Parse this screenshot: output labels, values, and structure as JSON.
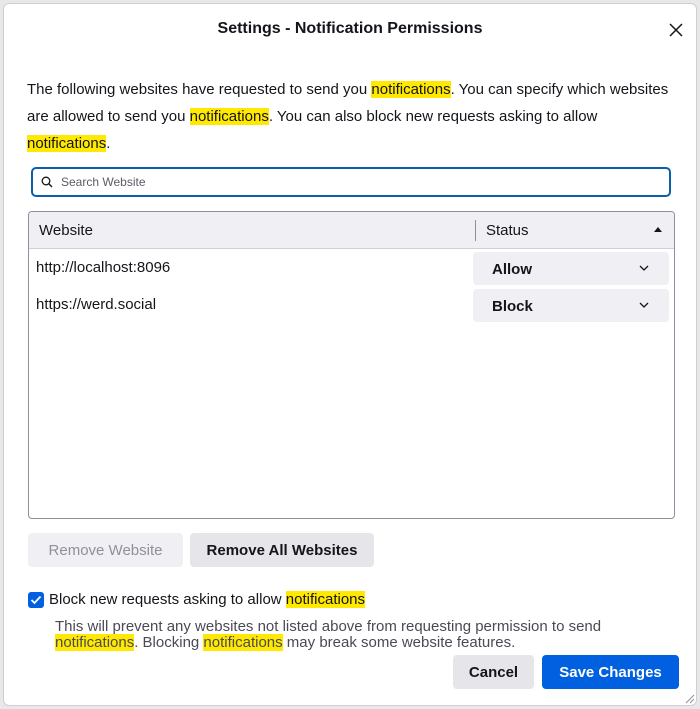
{
  "dialog": {
    "title": "Settings - Notification Permissions"
  },
  "description": {
    "p1": "The following websites have requested to send you ",
    "h1": "notifications",
    "p2": ". You can specify which websites are allowed to send you ",
    "h2": "notifications",
    "p3": ". You can also block new requests asking to allow ",
    "h3": "notifications",
    "p4": "."
  },
  "search": {
    "placeholder": "Search Website",
    "value": ""
  },
  "table": {
    "headers": {
      "website": "Website",
      "status": "Status"
    },
    "rows": [
      {
        "website": "http://localhost:8096",
        "status": "Allow"
      },
      {
        "website": "https://werd.social",
        "status": "Block"
      }
    ]
  },
  "buttons": {
    "remove_website": "Remove Website",
    "remove_all": "Remove All Websites",
    "cancel": "Cancel",
    "save": "Save Changes"
  },
  "block_option": {
    "checked": true,
    "label_prefix": "Block new requests asking to allow ",
    "label_highlight": "notifications",
    "desc_p1": "This will prevent any websites not listed above from requesting permission to send ",
    "desc_h1": "notifications",
    "desc_p2": ". Blocking ",
    "desc_h2": "notifications",
    "desc_p3": " may break some website features."
  },
  "colors": {
    "accent": "#0060df",
    "highlight": "#ffe900",
    "focus_border": "#0a5fa8"
  },
  "icons": {
    "close": "close-icon",
    "search": "search-icon",
    "sort": "sort-ascending-icon",
    "dropdown": "chevron-down-icon",
    "check": "checkmark-icon",
    "resize": "resize-grip-icon"
  }
}
